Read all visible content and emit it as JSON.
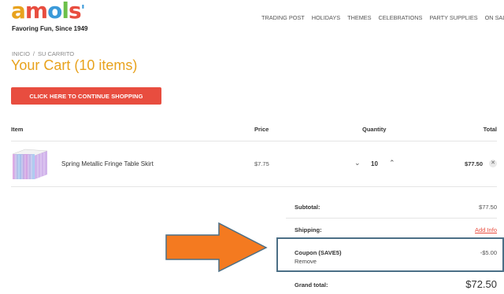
{
  "brand": {
    "logo_text": "amols",
    "tagline": "Favoring Fun, Since 1949"
  },
  "nav": {
    "items": [
      "TRADING POST",
      "HOLIDAYS",
      "THEMES",
      "CELEBRATIONS",
      "PARTY SUPPLIES",
      "ON SALE"
    ]
  },
  "breadcrumb": {
    "home": "INICIO",
    "separator": "/",
    "current": "SU CARRITO"
  },
  "page": {
    "title": "Your Cart (10 items)"
  },
  "buttons": {
    "continue_shopping": "CLICK HERE TO CONTINUE SHOPPING"
  },
  "table": {
    "headers": {
      "item": "Item",
      "price": "Price",
      "quantity": "Quantity",
      "total": "Total"
    },
    "rows": [
      {
        "name": "Spring Metallic Fringe Table Skirt",
        "price": "$7.75",
        "quantity": "10",
        "total": "$77.50"
      }
    ]
  },
  "summary": {
    "subtotal_label": "Subtotal:",
    "subtotal_value": "$77.50",
    "shipping_label": "Shipping:",
    "shipping_value": "Add Info",
    "coupon_label": "Coupon (SAVE5)",
    "coupon_value": "-$5.00",
    "coupon_remove": "Remove",
    "grand_total_label": "Grand total:",
    "grand_total_value": "$72.50"
  },
  "colors": {
    "accent_orange": "#e8a21d",
    "button_red": "#e84d3f",
    "highlight_border": "#4b6f86",
    "arrow_fill": "#f47a20"
  },
  "icons": {
    "qty_decrease": "chevron-down-icon",
    "qty_increase": "chevron-up-icon",
    "remove_item": "close-icon",
    "annotation": "arrow-right-icon"
  }
}
